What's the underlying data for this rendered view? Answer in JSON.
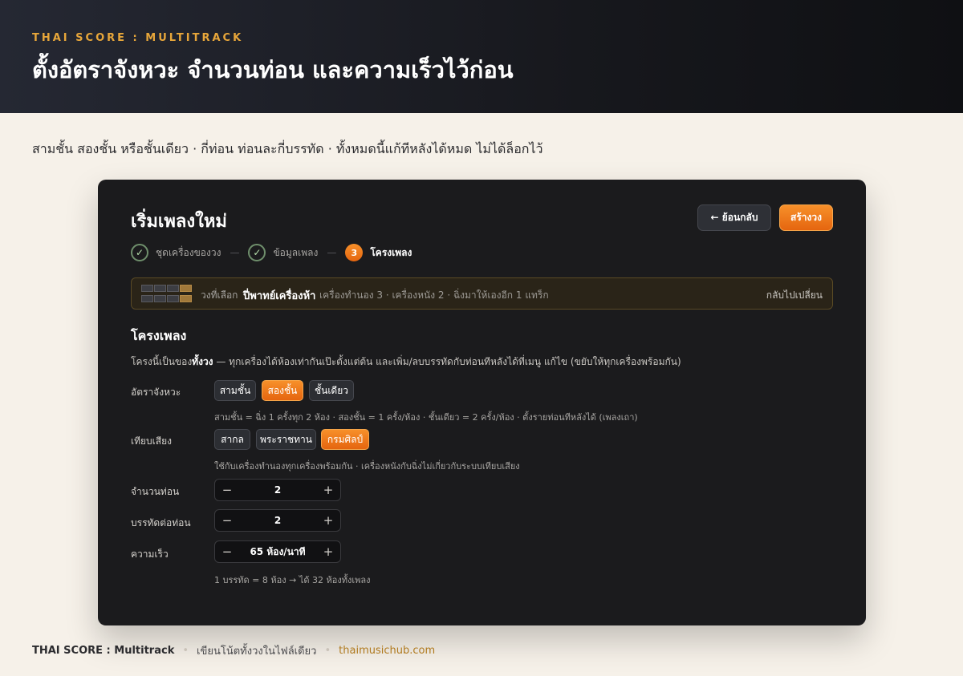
{
  "header": {
    "eyebrow": "THAI SCORE : MULTITRACK",
    "title": "ตั้งอัตราจังหวะ จำนวนท่อน และความเร็วไว้ก่อน"
  },
  "subline": "สามชั้น สองชั้น หรือชั้นเดียว · กี่ท่อน ท่อนละกี่บรรทัด · ทั้งหมดนี้แก้ทีหลังได้หมด ไม่ได้ล็อกไว้",
  "card": {
    "title": "เริ่มเพลงใหม่",
    "back_label": "← ย้อนกลับ",
    "create_label": "สร้างวง",
    "steps": [
      {
        "label": "ชุดเครื่องของวง",
        "state": "done",
        "mark": "✓"
      },
      {
        "label": "ข้อมูลเพลง",
        "state": "done",
        "mark": "✓"
      },
      {
        "label": "โครงเพลง",
        "state": "active",
        "mark": "3"
      }
    ],
    "step_separator": "—",
    "band": {
      "label": "วงที่เลือก",
      "name": "ปี่พาทย์เครื่องห้า",
      "desc": "เครื่องทำนอง 3 · เครื่องหนัง 2 · ฉิ่งมาให้เองอีก 1 แทร็ก",
      "change_label": "กลับไปเปลี่ยน"
    },
    "structure": {
      "title": "โครงเพลง",
      "desc_prefix": "โครงนี้เป็นของ",
      "desc_bold": "ทั้งวง",
      "desc_suffix": " — ทุกเครื่องได้ห้องเท่ากันเป๊ะตั้งแต่ต้น และเพิ่ม/ลบบรรทัดกับท่อนทีหลังได้ที่เมนู แก้ไข (ขยับให้ทุกเครื่องพร้อมกัน)"
    },
    "rate": {
      "label": "อัตราจังหวะ",
      "options": [
        "สามชั้น",
        "สองชั้น",
        "ชั้นเดียว"
      ],
      "selected": "สองชั้น",
      "hint": "สามชั้น = ฉิ่ง 1 ครั้งทุก 2 ห้อง · สองชั้น = 1 ครั้ง/ห้อง · ชั้นเดียว = 2 ครั้ง/ห้อง · ตั้งรายท่อนทีหลังได้ (เพลงเถา)"
    },
    "tuning": {
      "label": "เทียบเสียง",
      "options": [
        "สากล",
        "พระราชทาน",
        "กรมศิลป์"
      ],
      "selected": "กรมศิลป์",
      "hint": "ใช้กับเครื่องทำนองทุกเครื่องพร้อมกัน · เครื่องหนังกับฉิ่งไม่เกี่ยวกับระบบเทียบเสียง"
    },
    "sections": {
      "label": "จำนวนท่อน",
      "value": "2"
    },
    "lines_per_section": {
      "label": "บรรทัดต่อท่อน",
      "value": "2"
    },
    "tempo": {
      "label": "ความเร็ว",
      "value": "65 ห้อง/นาที"
    },
    "stepper_minus": "−",
    "stepper_plus": "+",
    "summary": "1 บรรทัด = 8 ห้อง → ได้ 32 ห้องทั้งเพลง"
  },
  "footer": {
    "brand": "THAI SCORE : Multitrack",
    "tagline": "เขียนโน้ตทั้งวงในไฟล์เดียว",
    "link": "thaimusichub.com",
    "separator": "•"
  }
}
